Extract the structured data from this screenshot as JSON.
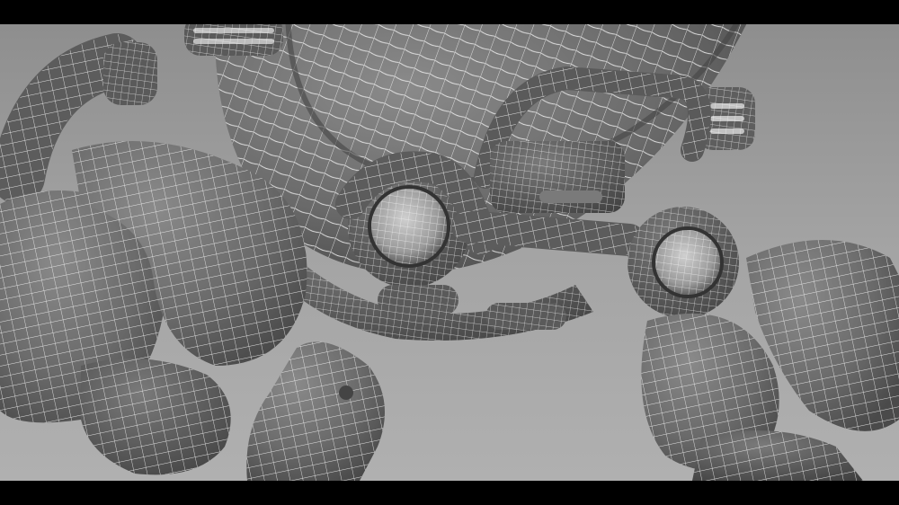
{
  "scene": {
    "subject": "robot-wireframe-render",
    "background_color": "#9a9a9a",
    "mesh_color": "#6e6e6e",
    "wire_color": "#f2f2f2",
    "letterbox_color": "#000000"
  }
}
